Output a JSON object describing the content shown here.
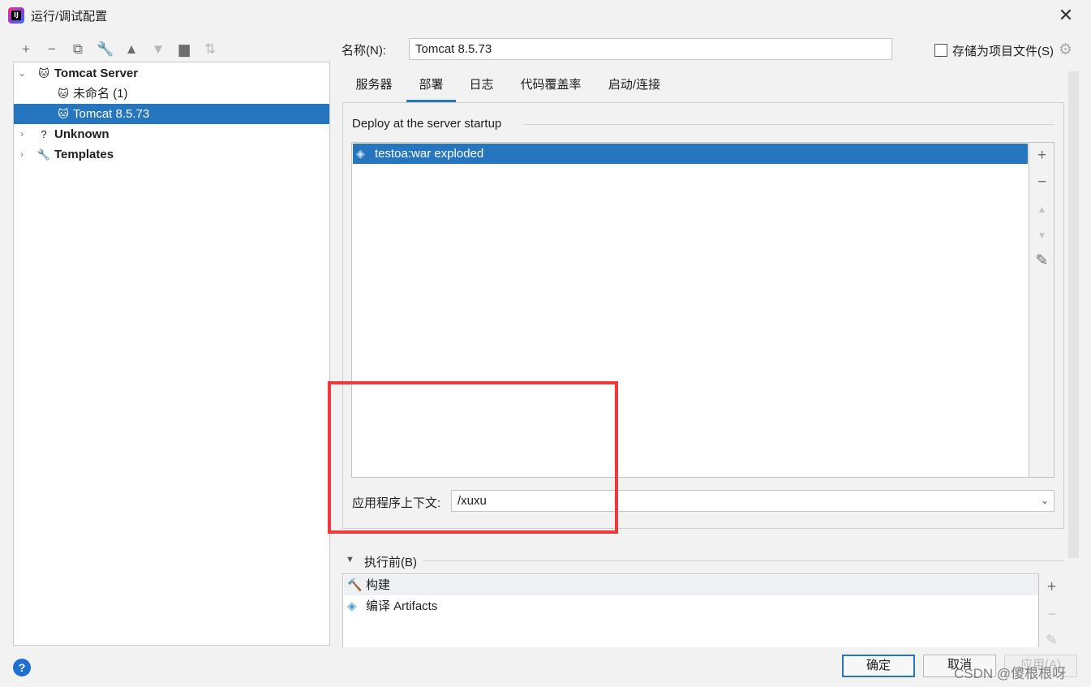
{
  "window": {
    "title": "运行/调试配置",
    "close": "✕",
    "app_icon_text": "IJ"
  },
  "toolbar": [
    {
      "name": "add-icon",
      "glyph": "+",
      "disabled": false
    },
    {
      "name": "remove-icon",
      "glyph": "−",
      "disabled": false
    },
    {
      "name": "copy-icon",
      "glyph": "⧉",
      "disabled": false
    },
    {
      "name": "wrench-icon",
      "glyph": "🔧",
      "disabled": false
    },
    {
      "name": "move-up-icon",
      "glyph": "▲",
      "disabled": false
    },
    {
      "name": "move-down-icon",
      "glyph": "▼",
      "disabled": true
    },
    {
      "name": "new-folder-icon",
      "glyph": "▆",
      "disabled": false
    },
    {
      "name": "sort-icon",
      "glyph": "⇅",
      "disabled": true
    }
  ],
  "tree": [
    {
      "label": "Tomcat Server",
      "expander": "⌄",
      "icon": "🐱",
      "bold": true,
      "selected": false
    },
    {
      "label": "未命名 (1)",
      "expander": "",
      "icon": "🐱",
      "bold": false,
      "selected": false
    },
    {
      "label": "Tomcat 8.5.73",
      "expander": "",
      "icon": "🐱",
      "bold": false,
      "selected": true
    },
    {
      "label": "Unknown",
      "expander": "›",
      "icon": "?",
      "bold": true,
      "selected": false
    },
    {
      "label": "Templates",
      "expander": "›",
      "icon": "🔧",
      "bold": true,
      "selected": false
    }
  ],
  "name_field": {
    "label": "名称(N):",
    "value": "Tomcat 8.5.73"
  },
  "store_as_project": {
    "label": "存储为项目文件(S)",
    "checked": false,
    "gear": "⚙"
  },
  "tabs": [
    {
      "label": "服务器",
      "active": false
    },
    {
      "label": "部署",
      "active": true
    },
    {
      "label": "日志",
      "active": false
    },
    {
      "label": "代码覆盖率",
      "active": false
    },
    {
      "label": "启动/连接",
      "active": false
    }
  ],
  "deploy": {
    "section_title": "Deploy at the server startup",
    "items": [
      {
        "label": "testoa:war exploded",
        "icon": "◈"
      }
    ],
    "side_buttons": [
      {
        "name": "add-icon",
        "glyph": "+",
        "disabled": false
      },
      {
        "name": "remove-icon",
        "glyph": "−",
        "disabled": false
      },
      {
        "name": "move-up-icon",
        "glyph": "▲",
        "disabled": true
      },
      {
        "name": "move-down-icon",
        "glyph": "▼",
        "disabled": true
      },
      {
        "name": "edit-icon",
        "glyph": "✎",
        "disabled": false
      }
    ]
  },
  "context": {
    "label": "应用程序上下文:",
    "value": "/xuxu",
    "chevron": "⌄"
  },
  "before_launch": {
    "title": "执行前(B)",
    "toggle": "▼",
    "items": [
      {
        "label": "构建",
        "icon": "🔨",
        "color": "#3a9e4a"
      },
      {
        "label": "编译 Artifacts",
        "icon": "◈",
        "color": "#4a9fd8"
      }
    ],
    "side_buttons": [
      {
        "name": "add-icon",
        "glyph": "+",
        "disabled": false
      },
      {
        "name": "remove-icon",
        "glyph": "−",
        "disabled": true
      },
      {
        "name": "edit-icon",
        "glyph": "✎",
        "disabled": true
      }
    ]
  },
  "footer": {
    "help": "?",
    "ok": "确定",
    "cancel": "取消",
    "apply": "应用(A)",
    "watermark": "CSDN @傻根根呀"
  },
  "colors": {
    "accent": "#2675bf",
    "highlight": "#ee3a3f"
  }
}
